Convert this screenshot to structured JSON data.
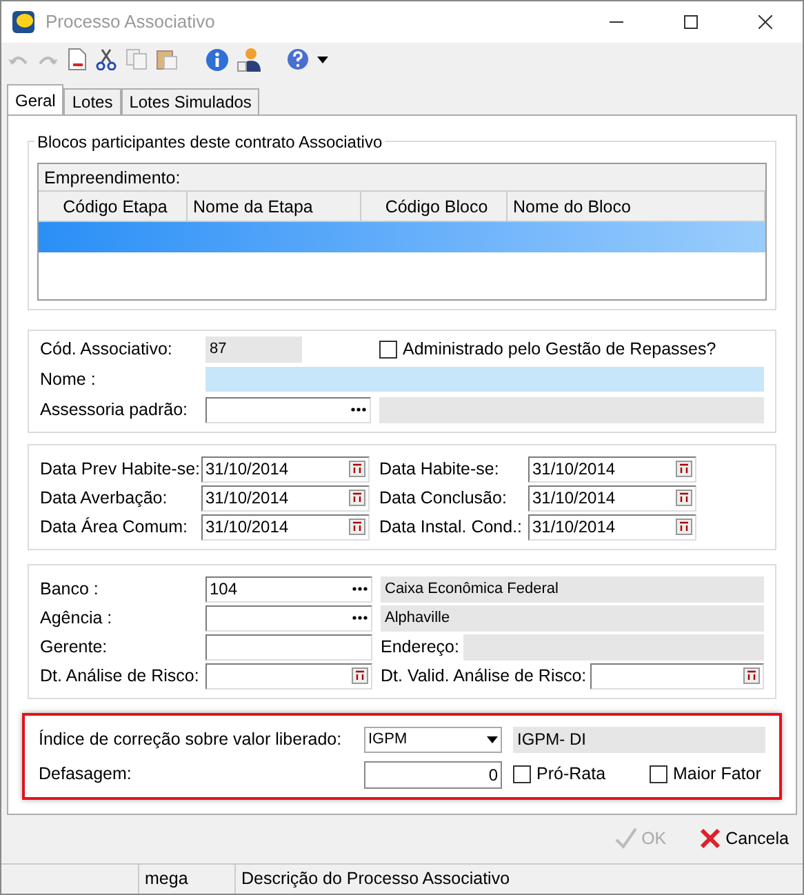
{
  "window": {
    "title": "Processo Associativo"
  },
  "tabs": [
    {
      "label": "Geral",
      "selected": true
    },
    {
      "label": "Lotes",
      "selected": false
    },
    {
      "label": "Lotes Simulados",
      "selected": false
    }
  ],
  "blocos": {
    "title": "Blocos participantes deste contrato Associativo",
    "empreendimento_label": "Empreendimento:",
    "columns": [
      "Código Etapa",
      "Nome da Etapa",
      "Código Bloco",
      "Nome do Bloco"
    ],
    "rows": [
      {
        "selected": true
      }
    ]
  },
  "associativo": {
    "cod_label": "Cód. Associativo:",
    "cod_value": "87",
    "administrado": {
      "label": "Administrado pelo Gestão de Repasses?",
      "checked": false
    },
    "nome_label": "Nome :",
    "assessoria_label": "Assessoria padrão:"
  },
  "dates": [
    {
      "label": "Data Prev Habite-se:",
      "value": "31/10/2014"
    },
    {
      "label": "Data Habite-se:",
      "value": "31/10/2014"
    },
    {
      "label": "Data Averbação:",
      "value": "31/10/2014"
    },
    {
      "label": "Data Conclusão:",
      "value": "31/10/2014"
    },
    {
      "label": "Data Área Comum:",
      "value": "31/10/2014"
    },
    {
      "label": "Data Instal. Cond.:",
      "value": "31/10/2014"
    }
  ],
  "banco": {
    "banco_label": "Banco :",
    "banco_value": "104",
    "banco_name": "Caixa Econômica Federal",
    "agencia_label": "Agência :",
    "agencia_name": "Alphaville",
    "gerente_label": "Gerente:",
    "endereco_label": "Endereço:",
    "analise_label": "Dt. Análise de Risco:",
    "valid_label": "Dt. Valid. Análise de Risco:"
  },
  "indice": {
    "label": "Índice de correção sobre valor liberado:",
    "value": "IGPM",
    "description": "IGPM- DI",
    "defasagem_label": "Defasagem:",
    "defasagem_value": "0",
    "checks": [
      {
        "label": "Pró-Rata",
        "checked": false
      },
      {
        "label": "Maior Fator",
        "checked": false
      }
    ]
  },
  "buttons": [
    {
      "kind": "ok",
      "label": "OK",
      "disabled": true
    },
    {
      "kind": "cancel",
      "label": "Cancela",
      "disabled": false
    }
  ],
  "status_bar": {
    "user": "mega",
    "description": "Descrição do Processo Associativo"
  }
}
